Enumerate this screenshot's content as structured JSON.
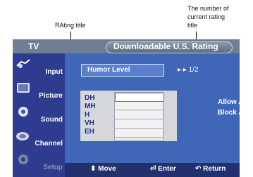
{
  "annotations": {
    "rating_title": "RAting title",
    "current_rating": [
      "The number of",
      "current rating",
      "title"
    ]
  },
  "header": {
    "tv_label": "TV",
    "title": "Downloadable U.S. Rating"
  },
  "sidebar": {
    "items": [
      {
        "label": "Input",
        "icon": "input-icon"
      },
      {
        "label": "Picture",
        "icon": "picture-icon"
      },
      {
        "label": "Sound",
        "icon": "sound-icon"
      },
      {
        "label": "Channel",
        "icon": "channel-icon"
      },
      {
        "label": "Setup",
        "icon": "setup-icon"
      }
    ]
  },
  "main": {
    "rating_label": "Humor Level",
    "rating_value": "1/2",
    "rows": [
      "DH",
      "MH",
      "H",
      "VH",
      "EH"
    ],
    "buttons": {
      "allow_all": "Allow All",
      "block_all": "Block All"
    }
  },
  "footer": {
    "move": "Move",
    "enter": "Enter",
    "return": "Return"
  },
  "colors": {
    "panel_bg": "#3f66b7",
    "sidebar_bg": "#2d3c8e",
    "header_bg": "#6f7f93"
  }
}
